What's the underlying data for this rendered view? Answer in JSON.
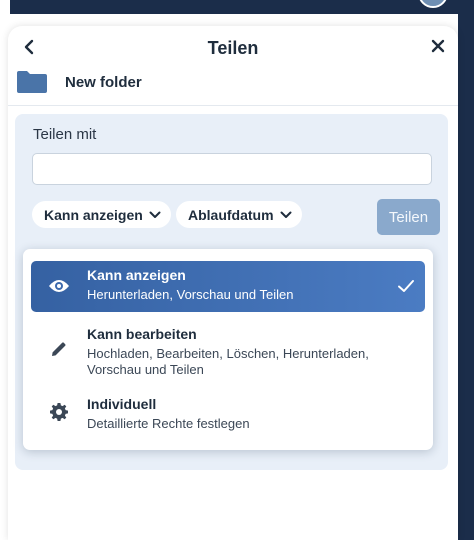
{
  "dialog": {
    "title": "Teilen",
    "folder_name": "New folder"
  },
  "share": {
    "label": "Teilen mit",
    "input_value": "",
    "input_placeholder": "",
    "permission_chip": "Kann anzeigen",
    "expiry_chip": "Ablaufdatum",
    "submit_label": "Teilen"
  },
  "permission_menu": {
    "options": [
      {
        "title": "Kann anzeigen",
        "description": "Herunterladen, Vorschau und Teilen",
        "icon": "eye-icon",
        "selected": true
      },
      {
        "title": "Kann bearbeiten",
        "description": "Hochladen, Bearbeiten, Löschen, Herunterladen, Vorschau und Teilen",
        "icon": "pencil-icon",
        "selected": false
      },
      {
        "title": "Individuell",
        "description": "Detaillierte Rechte festlegen",
        "icon": "gear-icon",
        "selected": false
      }
    ]
  },
  "colors": {
    "accent": "#3561a2",
    "share_button": "#8aa9cc",
    "share_box": "#e8eff8",
    "folder": "#4a74a8"
  }
}
